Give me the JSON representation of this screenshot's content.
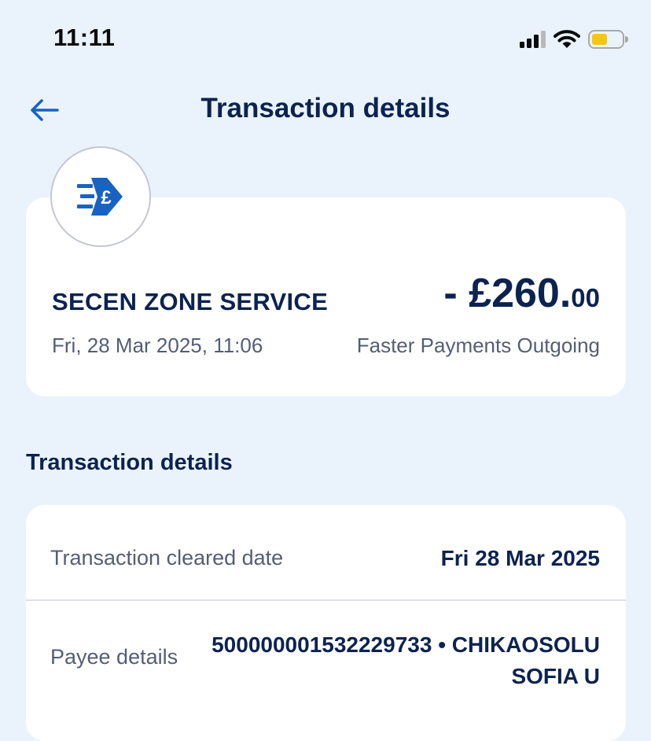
{
  "status_bar": {
    "time": "11:11",
    "battery_color": "#f6c518"
  },
  "nav": {
    "title": "Transaction details",
    "back_icon": "arrow-left-icon"
  },
  "summary": {
    "merchant_icon": "faster-payment-pound-icon",
    "merchant": "SECEN ZONE SERVICE",
    "date": "Fri, 28 Mar 2025, 11:06",
    "amount_main": "- £260.",
    "amount_pence": "00",
    "type": "Faster Payments Outgoing",
    "brand_color": "#1763c3"
  },
  "details": {
    "section_title": "Transaction details",
    "rows": [
      {
        "label": "Transaction cleared date",
        "value": "Fri 28 Mar 2025"
      },
      {
        "label": "Payee details",
        "value": "500000001532229733 • CHIKAOSOLU SOFIA U"
      }
    ]
  }
}
